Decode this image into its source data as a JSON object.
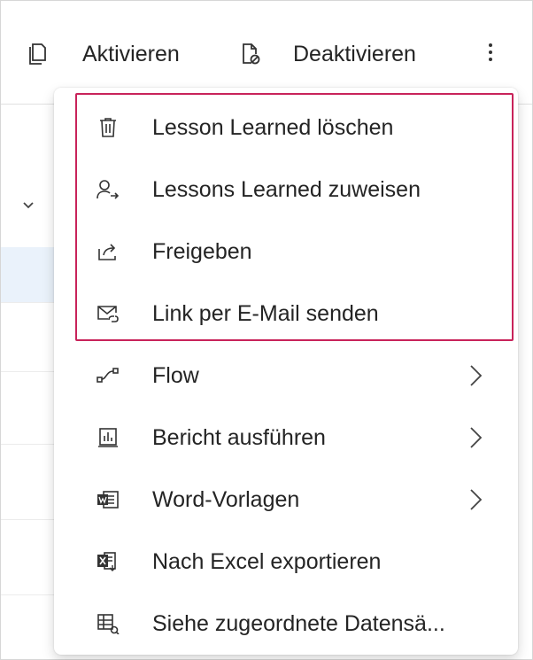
{
  "toolbar": {
    "activate_label": "Aktivieren",
    "deactivate_label": "Deaktivieren",
    "more_icon": "more-vertical-icon"
  },
  "menu": {
    "highlight_color": "#c8235a",
    "items": [
      {
        "label": "Lesson Learned löschen",
        "icon": "trash-icon",
        "submenu": false
      },
      {
        "label": "Lessons Learned zuweisen",
        "icon": "assign-person-icon",
        "submenu": false
      },
      {
        "label": "Freigeben",
        "icon": "share-icon",
        "submenu": false
      },
      {
        "label": "Link per E-Mail senden",
        "icon": "email-link-icon",
        "submenu": false
      },
      {
        "label": "Flow",
        "icon": "flow-icon",
        "submenu": true
      },
      {
        "label": "Bericht ausführen",
        "icon": "report-icon",
        "submenu": true
      },
      {
        "label": "Word-Vorlagen",
        "icon": "word-icon",
        "submenu": true
      },
      {
        "label": "Nach Excel exportieren",
        "icon": "excel-icon",
        "submenu": false
      },
      {
        "label": "Siehe zugeordnete Datensä...",
        "icon": "related-records-icon",
        "submenu": false
      }
    ]
  }
}
